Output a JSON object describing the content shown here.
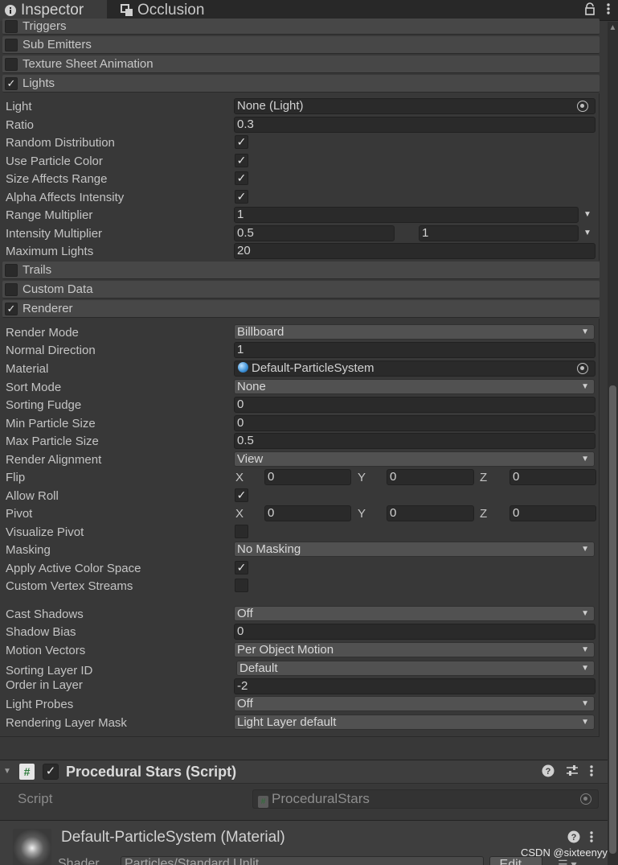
{
  "tabs": [
    {
      "label": "Inspector",
      "icon": "info-icon"
    },
    {
      "label": "Occlusion",
      "icon": "occlusion-icon"
    }
  ],
  "tab_actions": {
    "lock": "lock-icon",
    "menu": "kebab-menu-icon"
  },
  "modules_top": [
    {
      "label": "Triggers",
      "checked": false
    },
    {
      "label": "Sub Emitters",
      "checked": false
    },
    {
      "label": "Texture Sheet Animation",
      "checked": false
    },
    {
      "label": "Lights",
      "checked": true
    }
  ],
  "lights": {
    "light": {
      "label": "Light",
      "value": "None (Light)"
    },
    "ratio": {
      "label": "Ratio",
      "value": "0.3"
    },
    "random_distribution": {
      "label": "Random Distribution",
      "checked": true
    },
    "use_particle_color": {
      "label": "Use Particle Color",
      "checked": true
    },
    "size_affects_range": {
      "label": "Size Affects Range",
      "checked": true
    },
    "alpha_affects_intensity": {
      "label": "Alpha Affects Intensity",
      "checked": true
    },
    "range_multiplier": {
      "label": "Range Multiplier",
      "value": "1"
    },
    "intensity_multiplier": {
      "label": "Intensity Multiplier",
      "min": "0.5",
      "max": "1"
    },
    "maximum_lights": {
      "label": "Maximum Lights",
      "value": "20"
    }
  },
  "modules_mid": [
    {
      "label": "Trails",
      "checked": false
    },
    {
      "label": "Custom Data",
      "checked": false
    },
    {
      "label": "Renderer",
      "checked": true
    }
  ],
  "renderer": {
    "render_mode": {
      "label": "Render Mode",
      "value": "Billboard"
    },
    "normal_direction": {
      "label": "Normal Direction",
      "value": "1"
    },
    "material": {
      "label": "Material",
      "value": "Default-ParticleSystem"
    },
    "sort_mode": {
      "label": "Sort Mode",
      "value": "None"
    },
    "sorting_fudge": {
      "label": "Sorting Fudge",
      "value": "0"
    },
    "min_particle_size": {
      "label": "Min Particle Size",
      "value": "0"
    },
    "max_particle_size": {
      "label": "Max Particle Size",
      "value": "0.5"
    },
    "render_alignment": {
      "label": "Render Alignment",
      "value": "View"
    },
    "flip": {
      "label": "Flip",
      "x": "0",
      "y": "0",
      "z": "0"
    },
    "allow_roll": {
      "label": "Allow Roll",
      "checked": true
    },
    "pivot": {
      "label": "Pivot",
      "x": "0",
      "y": "0",
      "z": "0"
    },
    "visualize_pivot": {
      "label": "Visualize Pivot",
      "checked": false
    },
    "masking": {
      "label": "Masking",
      "value": "No Masking"
    },
    "apply_active_color_space": {
      "label": "Apply Active Color Space",
      "checked": true
    },
    "custom_vertex_streams": {
      "label": "Custom Vertex Streams",
      "checked": false
    },
    "cast_shadows": {
      "label": "Cast Shadows",
      "value": "Off"
    },
    "shadow_bias": {
      "label": "Shadow Bias",
      "value": "0"
    },
    "motion_vectors": {
      "label": "Motion Vectors",
      "value": "Per Object Motion"
    },
    "sorting_layer_id": {
      "label": "Sorting Layer ID",
      "value": "Default"
    },
    "order_in_layer": {
      "label": "Order in Layer",
      "value": "-2"
    },
    "light_probes": {
      "label": "Light Probes",
      "value": "Off"
    },
    "rendering_layer_mask": {
      "label": "Rendering Layer Mask",
      "value": "Light Layer default"
    }
  },
  "axes": {
    "x": "X",
    "y": "Y",
    "z": "Z"
  },
  "script_component": {
    "title": "Procedural Stars (Script)",
    "enabled": true,
    "script_label": "Script",
    "script_value": "ProceduralStars"
  },
  "material_component": {
    "title": "Default-ParticleSystem (Material)",
    "shader_label": "Shader",
    "shader_value": "Particles/Standard Unlit",
    "edit_label": "Edit..."
  },
  "watermark": "CSDN @sixteenyy",
  "colors": {
    "background": "#383838",
    "module_header": "#474747",
    "field": "#2a2a2a",
    "dropdown": "#515151",
    "tabbar": "#282828"
  }
}
